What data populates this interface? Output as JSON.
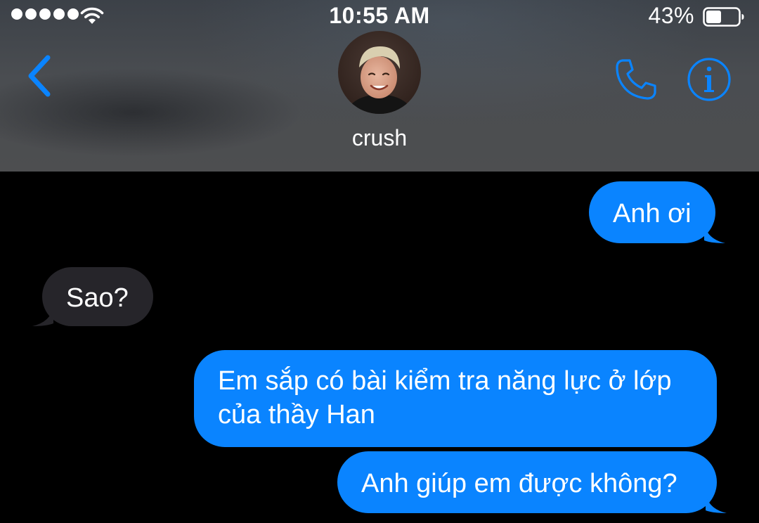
{
  "status_bar": {
    "signal_icon": "signal-dots-icon",
    "wifi_icon": "wifi-icon",
    "time": "10:55 AM",
    "battery_percent": "43%",
    "battery_icon": "battery-icon"
  },
  "nav": {
    "back_icon": "chevron-left-icon",
    "avatar_icon": "contact-avatar-photo",
    "contact_name": "crush",
    "call_icon": "phone-icon",
    "info_icon": "info-icon",
    "accent_color": "#0a84ff"
  },
  "messages": [
    {
      "direction": "outgoing",
      "text": "Anh ơi"
    },
    {
      "direction": "incoming",
      "text": "Sao?"
    },
    {
      "direction": "outgoing",
      "text": "Em sắp có bài kiểm tra năng lực ở lớp của thầy Han"
    },
    {
      "direction": "outgoing",
      "text": "Anh giúp em được không?"
    }
  ],
  "colors": {
    "outgoing_bubble": "#0a84ff",
    "incoming_bubble": "#26252a",
    "background": "#000000"
  }
}
